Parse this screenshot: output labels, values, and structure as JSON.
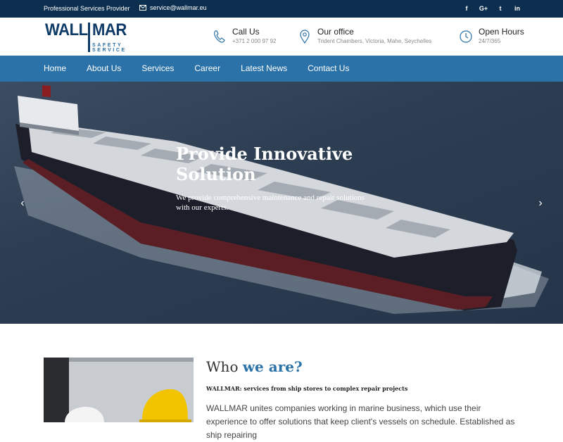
{
  "topbar": {
    "tagline": "Professional Services Provider",
    "email": "service@wallmar.eu",
    "socials": [
      {
        "icon": "facebook-icon",
        "glyph": "f"
      },
      {
        "icon": "google-plus-icon",
        "glyph": "G+"
      },
      {
        "icon": "twitter-icon",
        "glyph": "t"
      },
      {
        "icon": "linkedin-icon",
        "glyph": "in"
      }
    ]
  },
  "logo": {
    "wall": "WALL",
    "mar": "MAR",
    "line1": "SAFETY",
    "line2": "SERVICE"
  },
  "contact": {
    "call_title": "Call Us",
    "call_value": "+371 2 000 97 92",
    "office_title": "Our office",
    "office_value": "Trident Chambers, Victoria, Mahe, Seychelles",
    "hours_title": "Open Hours",
    "hours_value": "24/7/365"
  },
  "nav": {
    "items": [
      "Home",
      "About Us",
      "Services",
      "Career",
      "Latest News",
      "Contact Us"
    ]
  },
  "hero": {
    "title": "Provide Innovative Solution",
    "text": "We provide comprehensive maintenance and repair solutions with our experts.",
    "prev": "‹",
    "next": "›"
  },
  "about": {
    "title_plain": "Who ",
    "title_highlight": "we are?",
    "subtitle": "WALLMAR: services from ship stores to complex repair projects",
    "body": "WALLMAR unites companies working in marine business, which use their experience to offer solutions that keep client's vessels on schedule. Established as ship repairing"
  },
  "colors": {
    "topbar": "#0d2f4f",
    "nav": "#2a72a8",
    "accent": "#2a72a8",
    "logo": "#0d3a66"
  }
}
